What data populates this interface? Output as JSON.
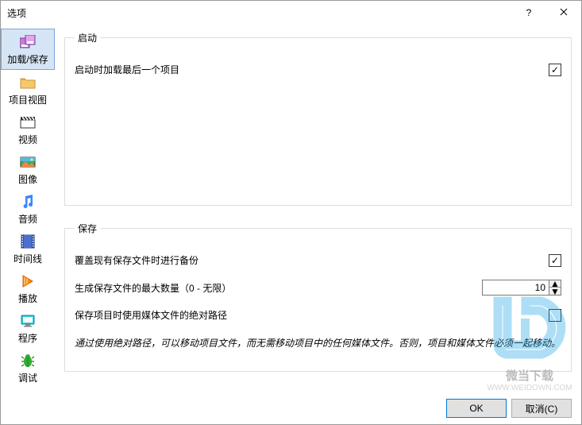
{
  "window": {
    "title": "选项"
  },
  "sidebar": {
    "items": [
      {
        "label": "加载/保存"
      },
      {
        "label": "项目视图"
      },
      {
        "label": "视频"
      },
      {
        "label": "图像"
      },
      {
        "label": "音频"
      },
      {
        "label": "时间线"
      },
      {
        "label": "播放"
      },
      {
        "label": "程序"
      },
      {
        "label": "调试"
      }
    ]
  },
  "startup": {
    "legend": "启动",
    "load_last_project": "启动时加载最后一个项目"
  },
  "save": {
    "legend": "保存",
    "backup_on_overwrite": "覆盖现有保存文件时进行备份",
    "max_saves_label": "生成保存文件的最大数量（0 - 无限）",
    "max_saves_value": "10",
    "absolute_paths": "保存项目时使用媒体文件的绝对路径",
    "note": "通过使用绝对路径，可以移动项目文件，而无需移动项目中的任何媒体文件。否则，项目和媒体文件必须一起移动。"
  },
  "footer": {
    "ok": "OK",
    "cancel": "取消(C)"
  },
  "watermark": {
    "text": "微当下载",
    "url": "WWW.WEIDOWN.COM"
  }
}
